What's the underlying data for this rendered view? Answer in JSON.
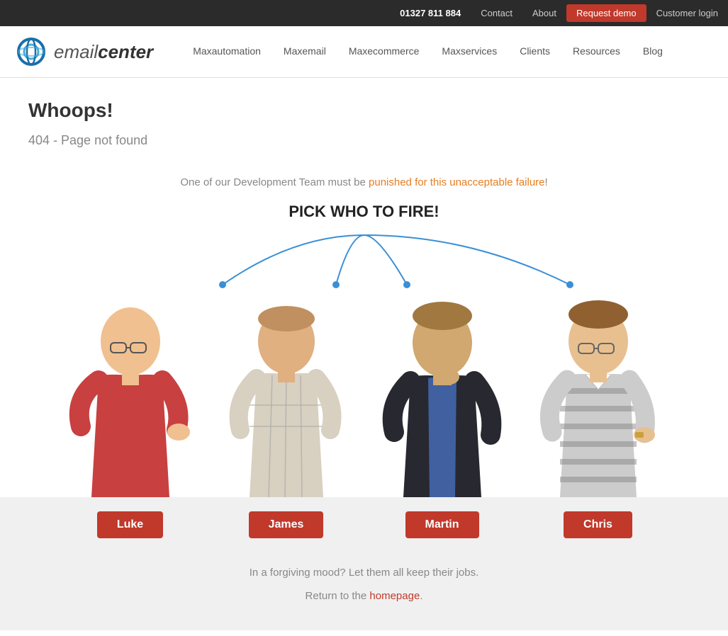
{
  "topbar": {
    "phone": "01327 811 884",
    "contact": "Contact",
    "about": "About",
    "request_demo": "Request demo",
    "customer_login": "Customer login"
  },
  "nav": {
    "logo_text": "emailcenter",
    "links": [
      {
        "label": "Maxautomation"
      },
      {
        "label": "Maxemail"
      },
      {
        "label": "Maxecommerce"
      },
      {
        "label": "Maxservices"
      },
      {
        "label": "Clients"
      },
      {
        "label": "Resources"
      },
      {
        "label": "Blog"
      }
    ]
  },
  "page": {
    "whoops": "Whoops!",
    "not_found": "404 - Page not found",
    "punishment_intro": "One of our Development Team must be ",
    "punishment_highlight": "punished for this unacceptable failure",
    "punishment_end": "!",
    "pick_title": "PICK WHO TO FIRE!",
    "forgiving_text": "In a forgiving mood? Let them all keep their jobs.",
    "return_text": "Return to the ",
    "return_link": "homepage",
    "return_period": "."
  },
  "people": [
    {
      "name": "Luke",
      "class": "luke"
    },
    {
      "name": "James",
      "class": "james"
    },
    {
      "name": "Martin",
      "class": "martin"
    },
    {
      "name": "Chris",
      "class": "chris"
    }
  ]
}
